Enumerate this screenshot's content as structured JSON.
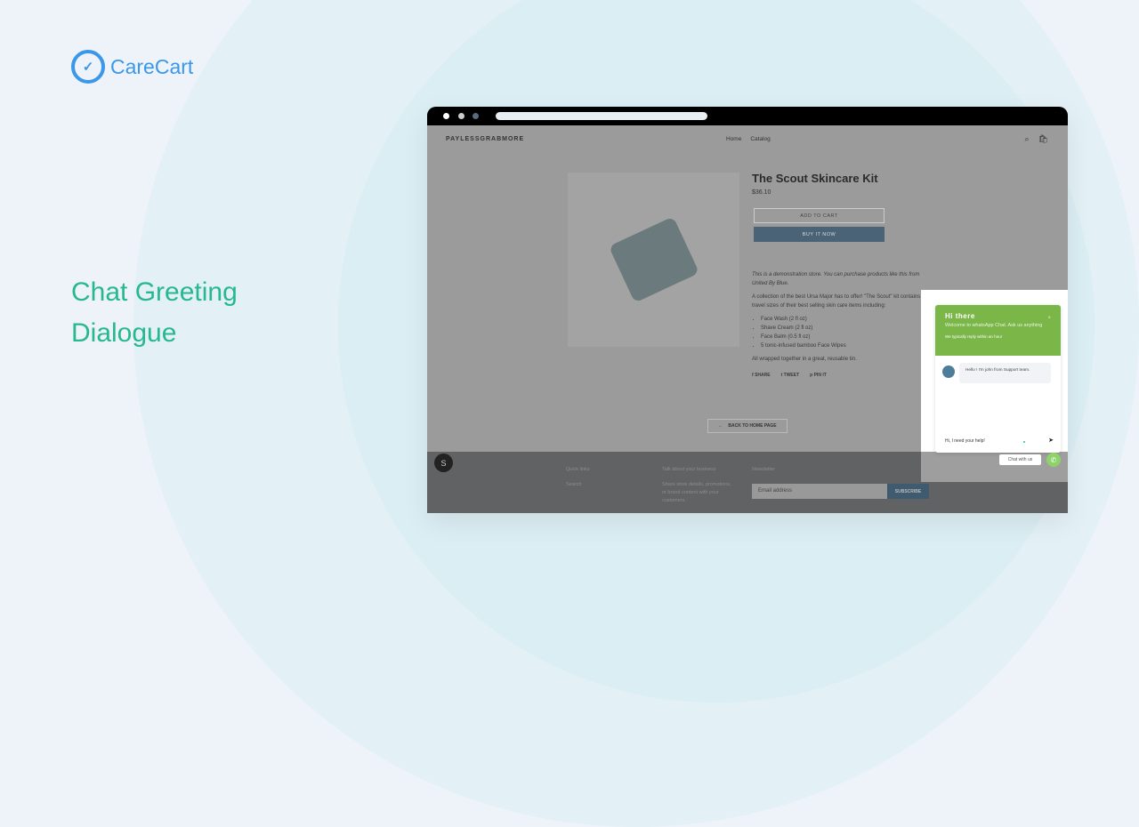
{
  "brand": {
    "logo_text": "CareCart",
    "headline": "Chat Greeting Dialogue",
    "accent": "#3a97ea",
    "headline_color": "#27b88e"
  },
  "store": {
    "name": "PAYLESSGRABMORE",
    "nav": [
      "Home",
      "Catalog"
    ],
    "product": {
      "title": "The Scout Skincare Kit",
      "price": "$36.10",
      "add_to_cart": "ADD TO CART",
      "buy_now": "BUY IT NOW",
      "demo_note": "This is a demonstration store. You can purchase products like this from United By Blue.",
      "description": "A collection of the best Ursa Major has to offer! \"The Scout\" kit contains travel sizes of their best selling skin care items including:",
      "items": [
        "Face Wash (2 fl oz)",
        "Shave Cream (2 fl oz)",
        "Face Balm (0.5 fl oz)",
        "5 tonic-infused bamboo Face Wipes"
      ],
      "closing": "All wrapped together in a great, reusable tin.",
      "share": [
        "SHARE",
        "TWEET",
        "PIN IT"
      ]
    },
    "back_label": "BACK TO HOME PAGE",
    "footer": {
      "quick_links": "Quick links",
      "search": "Search",
      "talk_title": "Talk about your business",
      "talk_text": "Share store details, promotions, or brand content with your customers.",
      "newsletter": "Newsletter",
      "email_placeholder": "Email address",
      "subscribe": "SUBSCRIBE"
    }
  },
  "chat": {
    "title": "Hi there",
    "welcome": "Welcome to whatsApp Chat. Ask us anything",
    "reply_time": "We typically reply within an hour",
    "message": "Hello ! I'm john from Support team.",
    "input_value": "Hi, I need your help!",
    "chat_with_us": "Chat with us",
    "header_color": "#7ab648"
  }
}
